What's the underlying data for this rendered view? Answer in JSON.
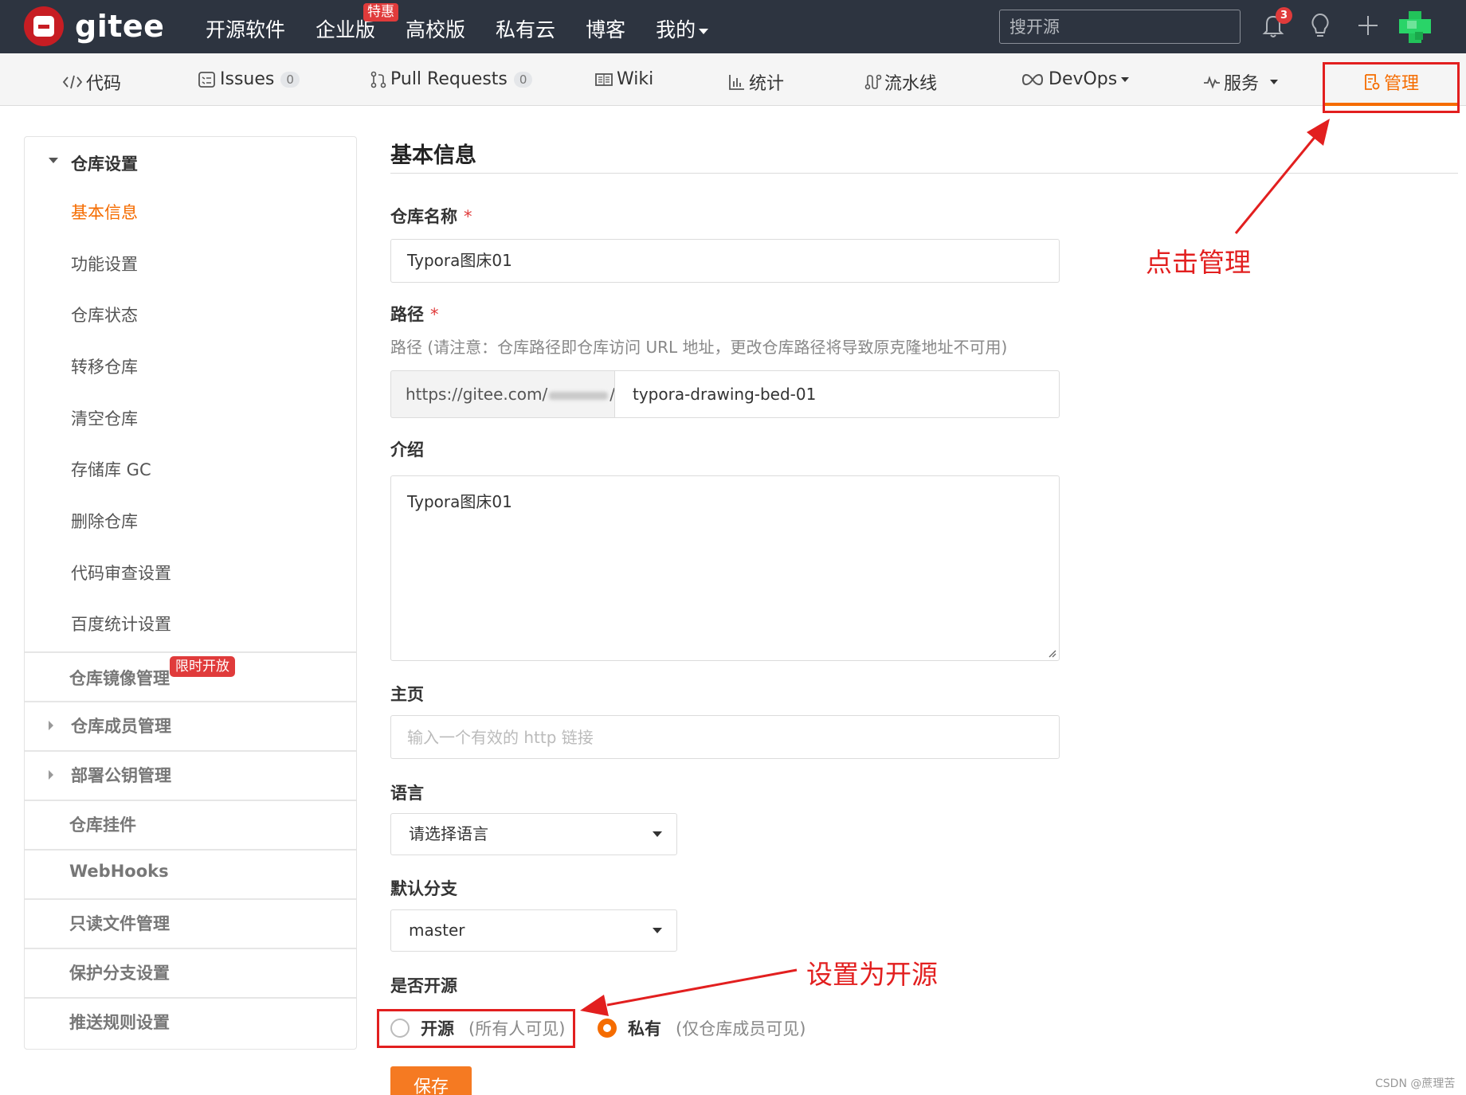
{
  "header": {
    "logo_text": "gitee",
    "nav": [
      {
        "label": "开源软件"
      },
      {
        "label": "企业版",
        "badge": "特惠"
      },
      {
        "label": "高校版"
      },
      {
        "label": "私有云"
      },
      {
        "label": "博客"
      },
      {
        "label": "我的"
      }
    ],
    "search_placeholder": "搜开源",
    "notification_count": "3",
    "icons": [
      "bell-icon",
      "lightbulb-icon",
      "plus-icon",
      "avatar"
    ]
  },
  "repo_tabs": [
    {
      "label": "代码",
      "icon": "code-icon"
    },
    {
      "label": "Issues",
      "count": "0",
      "icon": "issues-icon"
    },
    {
      "label": "Pull Requests",
      "count": "0",
      "icon": "pull-request-icon"
    },
    {
      "label": "Wiki",
      "icon": "wiki-icon"
    },
    {
      "label": "统计",
      "icon": "stats-icon"
    },
    {
      "label": "流水线",
      "icon": "pipeline-icon"
    },
    {
      "label": "DevOps",
      "icon": "infinity-icon"
    },
    {
      "label": "服务",
      "icon": "pulse-icon"
    },
    {
      "label": "管理",
      "icon": "manage-icon",
      "active": true
    }
  ],
  "sidebar": {
    "group_title": "仓库设置",
    "items": [
      {
        "label": "基本信息",
        "active": true
      },
      {
        "label": "功能设置"
      },
      {
        "label": "仓库状态"
      },
      {
        "label": "转移仓库"
      },
      {
        "label": "清空仓库"
      },
      {
        "label": "存储库 GC"
      },
      {
        "label": "删除仓库"
      },
      {
        "label": "代码审查设置"
      },
      {
        "label": "百度统计设置"
      }
    ],
    "sections": [
      {
        "label": "仓库镜像管理",
        "badge": "限时开放"
      },
      {
        "label": "仓库成员管理",
        "expandable": true
      },
      {
        "label": "部署公钥管理",
        "expandable": true
      },
      {
        "label": "仓库挂件"
      },
      {
        "label": "WebHooks"
      },
      {
        "label": "只读文件管理"
      },
      {
        "label": "保护分支设置"
      },
      {
        "label": "推送规则设置"
      }
    ]
  },
  "form": {
    "title": "基本信息",
    "repo_name": {
      "label": "仓库名称",
      "required": "*",
      "value": "Typora图床01"
    },
    "path": {
      "label": "路径",
      "required": "*",
      "hint": "路径 (请注意：仓库路径即仓库访问 URL 地址，更改仓库路径将导致原克隆地址不可用)",
      "prefix_start": "https://gitee.com/",
      "prefix_end": "/",
      "value": "typora-drawing-bed-01"
    },
    "description": {
      "label": "介绍",
      "value": "Typora图床01"
    },
    "homepage": {
      "label": "主页",
      "placeholder": "输入一个有效的 http 链接"
    },
    "language": {
      "label": "语言",
      "value": "请选择语言"
    },
    "default_branch": {
      "label": "默认分支",
      "value": "master"
    },
    "visibility": {
      "label": "是否开源",
      "options": [
        {
          "label": "开源",
          "desc": "(所有人可见)",
          "checked": false
        },
        {
          "label": "私有",
          "desc": "(仅仓库成员可见)",
          "checked": true
        }
      ]
    },
    "save_label": "保存"
  },
  "annotations": {
    "click_manage": "点击管理",
    "set_open_source": "设置为开源",
    "color": "#e21f1f"
  },
  "watermark": "CSDN @蔗理苦",
  "colors": {
    "accent": "#f56c00",
    "header_bg": "#2d3440",
    "danger": "#e03b3b"
  }
}
